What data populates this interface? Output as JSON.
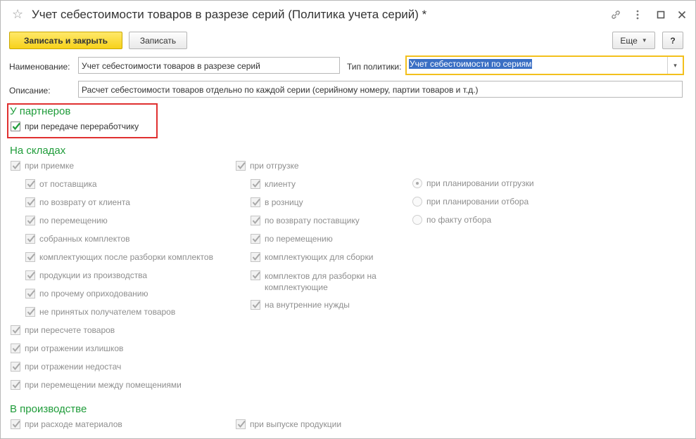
{
  "window": {
    "title": "Учет себестоимости товаров в разрезе серий (Политика учета серий) *"
  },
  "toolbar": {
    "save_close_label": "Записать и закрыть",
    "save_label": "Записать",
    "more_label": "Еще",
    "help_label": "?"
  },
  "form": {
    "name_label": "Наименование:",
    "name_value": "Учет себестоимости товаров в разрезе серий",
    "policy_label": "Тип политики:",
    "policy_value": "Учет себестоимости по сериям",
    "description_label": "Описание:",
    "description_value": "Расчет себестоимости товаров отдельно по каждой серии (серийному номеру, партии товаров и т.д.)"
  },
  "partners": {
    "title": "У партнеров",
    "transfer_label": "при передаче переработчику"
  },
  "warehouses": {
    "title": "На складах",
    "receipt_label": "при приемке",
    "receipt_items": [
      "от поставщика",
      "по возврату от клиента",
      "по перемещению",
      "собранных комплектов",
      "комплектующих после разборки комплектов",
      "продукции из производства",
      "по прочему оприходованию",
      "не принятых получателем товаров"
    ],
    "shipment_label": "при отгрузке",
    "shipment_items": [
      "клиенту",
      "в розницу",
      "по возврату поставщику",
      "по перемещению",
      "комплектующих для сборки",
      "комплектов для разборки на комплектующие",
      "на внутренние нужды"
    ],
    "timing_options": [
      "при планировании отгрузки",
      "при планировании отбора",
      "по факту отбора"
    ],
    "other_items": [
      "при пересчете товаров",
      "при отражении излишков",
      "при отражении недостач",
      "при перемещении между помещениями"
    ]
  },
  "production": {
    "title": "В производстве",
    "materials_label": "при расходе материалов",
    "output_label": "при выпуске продукции"
  }
}
